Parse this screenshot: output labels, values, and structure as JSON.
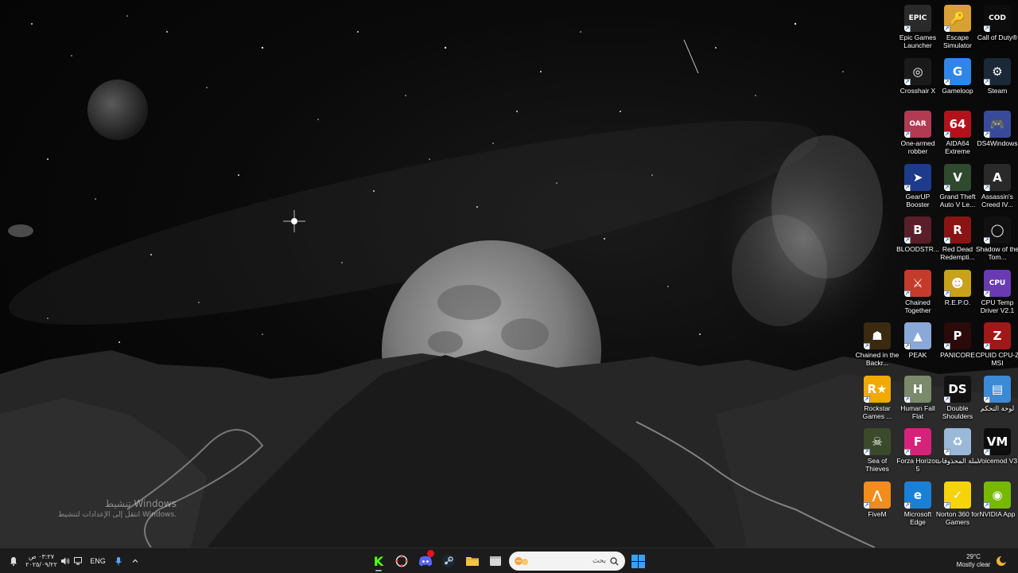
{
  "desktop": {
    "icons": [
      {
        "label": "Epic Games Launcher",
        "icon": "epic-games-icon",
        "color": "#2a2a2a",
        "glyph": "EPIC"
      },
      {
        "label": "Escape Simulator",
        "icon": "escape-simulator-icon",
        "color": "#d9a035",
        "glyph": "🔑"
      },
      {
        "label": "Call of Duty®",
        "icon": "call-of-duty-icon",
        "color": "#0d0d0d",
        "glyph": "COD"
      },
      {
        "label": "Crosshair X",
        "icon": "crosshair-icon",
        "color": "#1a1a1a",
        "glyph": "◎"
      },
      {
        "label": "Gameloop",
        "icon": "gameloop-icon",
        "color": "#2f86e6",
        "glyph": "G"
      },
      {
        "label": "Steam",
        "icon": "steam-icon",
        "color": "#1b2838",
        "glyph": "⚙"
      },
      {
        "label": "One-armed robber",
        "icon": "one-armed-robber-icon",
        "color": "#b23a52",
        "glyph": "OAR"
      },
      {
        "label": "AIDA64 Extreme",
        "icon": "aida64-icon",
        "color": "#b3121c",
        "glyph": "64"
      },
      {
        "label": "DS4Windows",
        "icon": "gamepad-icon",
        "color": "#3a4a9a",
        "glyph": "🎮"
      },
      {
        "label": "GearUP Booster",
        "icon": "gearup-icon",
        "color": "#1e3a8a",
        "glyph": "➤"
      },
      {
        "label": "Grand Theft Auto V Le...",
        "icon": "gta-v-icon",
        "color": "#2f4a2f",
        "glyph": "V"
      },
      {
        "label": "Assassin's Creed IV...",
        "icon": "assassins-creed-icon",
        "color": "#2a2a2a",
        "glyph": "A"
      },
      {
        "label": "BLOODSTR...",
        "icon": "bloodstrike-icon",
        "color": "#5a1e2a",
        "glyph": "B"
      },
      {
        "label": "Red Dead Redempti...",
        "icon": "red-dead-icon",
        "color": "#8a1414",
        "glyph": "R"
      },
      {
        "label": "Shadow of the Tom...",
        "icon": "shadow-tomb-raider-icon",
        "color": "#111111",
        "glyph": "◯"
      },
      {
        "label": "Chained Together",
        "icon": "chained-together-icon",
        "color": "#c43b2b",
        "glyph": "⚔"
      },
      {
        "label": "R.E.P.O.",
        "icon": "repo-icon",
        "color": "#c8a21a",
        "glyph": "☻"
      },
      {
        "label": "CPU Temp Driver V2.1",
        "icon": "cpu-temp-icon",
        "color": "#6a3ab2",
        "glyph": "CPU"
      },
      {
        "label": "Chained in the Backr...",
        "icon": "chained-backrooms-icon",
        "color": "#3a2a10",
        "glyph": "☗"
      },
      {
        "label": "PEAK",
        "icon": "peak-icon",
        "color": "#8aa8d8",
        "glyph": "▲"
      },
      {
        "label": "PANICORE",
        "icon": "panicore-icon",
        "color": "#2a0a0a",
        "glyph": "P"
      },
      {
        "label": "CPUID CPU-Z MSI",
        "icon": "cpuz-icon",
        "color": "#a01818",
        "glyph": "Z"
      },
      {
        "label": "Rockstar Games ...",
        "icon": "rockstar-icon",
        "color": "#f2a900",
        "glyph": "R★"
      },
      {
        "label": "Human Fall Flat",
        "icon": "human-fall-flat-icon",
        "color": "#7a8a6a",
        "glyph": "H"
      },
      {
        "label": "Double Shoulders",
        "icon": "double-shoulders-icon",
        "color": "#111111",
        "glyph": "DS"
      },
      {
        "label": "لوحة التحكم",
        "icon": "control-panel-icon",
        "color": "#3a8ad6",
        "glyph": "▤"
      },
      {
        "label": "Sea of Thieves",
        "icon": "sea-of-thieves-icon",
        "color": "#3a4a2a",
        "glyph": "☠"
      },
      {
        "label": "Forza Horizon 5",
        "icon": "forza-icon",
        "color": "#d6237a",
        "glyph": "F"
      },
      {
        "label": "سلة المحذوفات",
        "icon": "recycle-bin-icon",
        "color": "#9ab8d8",
        "glyph": "♻"
      },
      {
        "label": "Voicemod V3",
        "icon": "voicemod-icon",
        "color": "#0d0d0d",
        "glyph": "VM"
      },
      {
        "label": "FiveM",
        "icon": "fivem-icon",
        "color": "#f28c1c",
        "glyph": "⋀"
      },
      {
        "label": "Microsoft Edge",
        "icon": "edge-icon",
        "color": "#1b7fd6",
        "glyph": "e"
      },
      {
        "label": "Norton 360 for Gamers",
        "icon": "norton-icon",
        "color": "#f5d40a",
        "glyph": "✓"
      },
      {
        "label": "NVIDIA App",
        "icon": "nvidia-icon",
        "color": "#76b900",
        "glyph": "◉"
      }
    ]
  },
  "activation": {
    "title": "تنشيط Windows",
    "subtitle": "انتقل إلى الإعدادات لتنشيط Windows."
  },
  "taskbar": {
    "clock_time": "٠٣:٢٧ ص",
    "clock_date": "٢٠٢٥/٠٩/٢٢",
    "language": "ENG",
    "search_placeholder": "بحث",
    "weather_temp": "29°C",
    "weather_desc": "Mostly clear"
  }
}
